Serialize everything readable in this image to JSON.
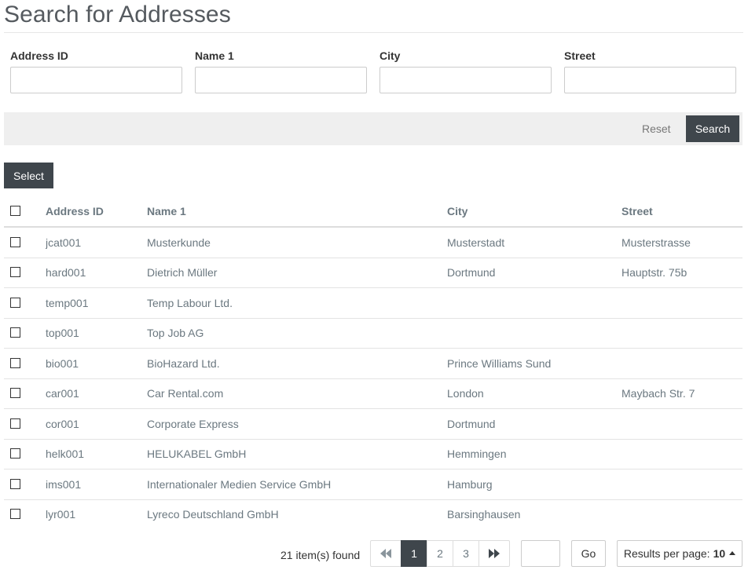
{
  "page": {
    "title": "Search for Addresses"
  },
  "search_form": {
    "fields": [
      {
        "label": "Address ID",
        "value": "",
        "placeholder": ""
      },
      {
        "label": "Name 1",
        "value": "",
        "placeholder": ""
      },
      {
        "label": "City",
        "value": "",
        "placeholder": ""
      },
      {
        "label": "Street",
        "value": "",
        "placeholder": ""
      }
    ],
    "reset_label": "Reset",
    "search_label": "Search"
  },
  "toolbar": {
    "select_label": "Select"
  },
  "table": {
    "columns": [
      "Address ID",
      "Name 1",
      "City",
      "Street"
    ],
    "rows": [
      {
        "id": "jcat001",
        "name": "Musterkunde",
        "city": "Musterstadt",
        "street": "Musterstrasse"
      },
      {
        "id": "hard001",
        "name": "Dietrich Müller",
        "city": "Dortmund",
        "street": "Hauptstr. 75b"
      },
      {
        "id": "temp001",
        "name": "Temp Labour Ltd.",
        "city": "",
        "street": ""
      },
      {
        "id": "top001",
        "name": "Top Job AG",
        "city": "",
        "street": ""
      },
      {
        "id": "bio001",
        "name": "BioHazard Ltd.",
        "city": "Prince Williams Sund",
        "street": ""
      },
      {
        "id": "car001",
        "name": "Car Rental.com",
        "city": "London",
        "street": "Maybach Str. 7"
      },
      {
        "id": "cor001",
        "name": "Corporate Express",
        "city": "Dortmund",
        "street": ""
      },
      {
        "id": "helk001",
        "name": "HELUKABEL GmbH",
        "city": "Hemmingen",
        "street": ""
      },
      {
        "id": "ims001",
        "name": "Internationaler Medien Service GmbH",
        "city": "Hamburg",
        "street": ""
      },
      {
        "id": "lyr001",
        "name": "Lyreco Deutschland GmbH",
        "city": "Barsinghausen",
        "street": ""
      }
    ]
  },
  "pagination": {
    "items_found": "21 item(s) found",
    "first_icon": "first-page-icon",
    "last_icon": "last-page-icon",
    "pages": [
      "1",
      "2",
      "3"
    ],
    "current_page": "1",
    "page_input_value": "",
    "go_label": "Go",
    "results_per_page_label": "Results per page:",
    "results_per_page_value": "10"
  }
}
